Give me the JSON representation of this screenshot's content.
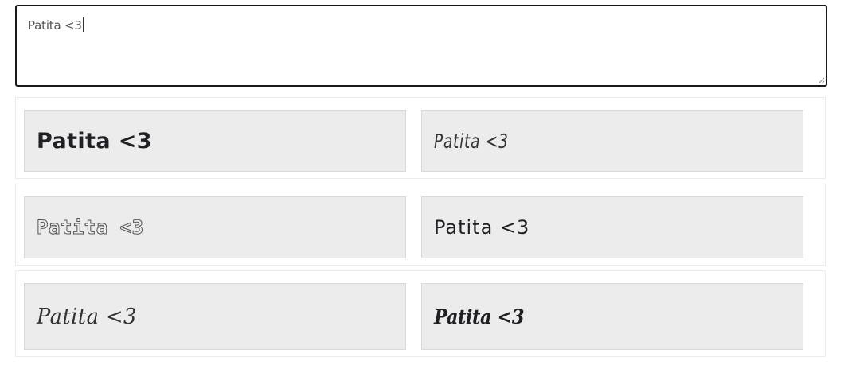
{
  "input": {
    "value": "Patita <3"
  },
  "previews": [
    {
      "text": "Patita <3",
      "style": "heavy-sans"
    },
    {
      "text": "Patita <3",
      "style": "handwritten-thin"
    },
    {
      "text": "Patita <3",
      "style": "outlined-mono"
    },
    {
      "text": "Patita <3",
      "style": "comic-casual"
    },
    {
      "text": "Patita <3",
      "style": "calligraphic-script"
    },
    {
      "text": "Patita <3",
      "style": "bold-script"
    }
  ],
  "colors": {
    "card_background": "#ececec",
    "input_border": "#1a1a1a",
    "text": "#222222"
  }
}
